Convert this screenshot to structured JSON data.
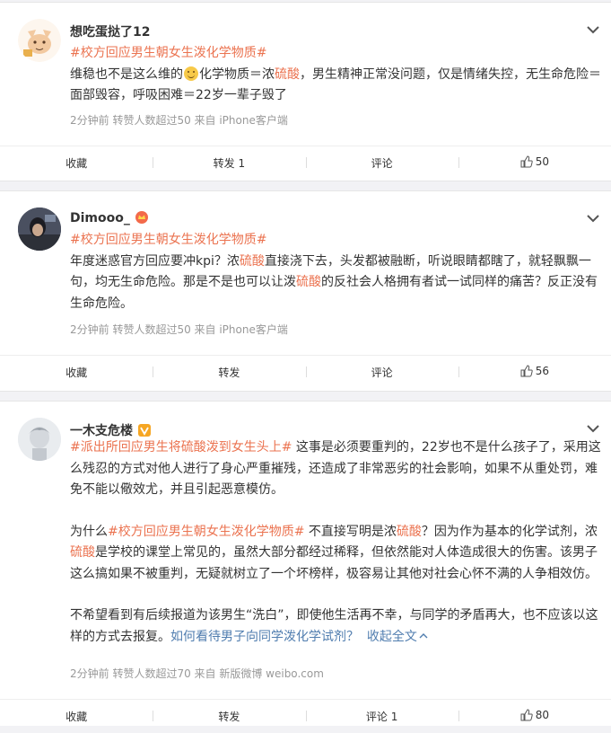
{
  "posts": [
    {
      "username": "想吃蛋挞了12",
      "topic": "#校方回应男生朝女生泼化学物质#",
      "text_a": "维稳也不是这么维的",
      "text_b": "化学物质＝浓",
      "text_c": "硫酸",
      "text_d": "，男生精神正常没问题，仅是情绪失控，无生命危险＝面部毁容，呼吸困难＝22岁一辈子毁了",
      "meta": "2分钟前  转赞人数超过50  来自 iPhone客户端",
      "actions": {
        "collect": "收藏",
        "repost": "转发 1",
        "comment": "评论",
        "likes": "50"
      }
    },
    {
      "username": "Dimooo_",
      "topic": "#校方回应男生朝女生泼化学物质#",
      "text_a": "年度迷惑官方回应要冲kpi？浓",
      "text_b": "硫酸",
      "text_c": "直接浇下去，头发都被融断，听说眼睛都瞎了，就轻飘飘一句，均无生命危险。那是不是也可以让泼",
      "text_d": "硫酸",
      "text_e": "的反社会人格拥有者试一试同样的痛苦？反正没有生命危险。",
      "meta": "2分钟前  转赞人数超过50  来自 iPhone客户端",
      "actions": {
        "collect": "收藏",
        "repost": "转发",
        "comment": "评论",
        "likes": "56"
      }
    },
    {
      "username": "一木支危楼",
      "p1_topic_a": "#派出所回应男生将",
      "p1_topic_b": "硫酸",
      "p1_topic_c": "泼到女生头上#",
      "p1_text": " 这事是必须要重判的，22岁也不是什么孩子了，采用这么残忍的方式对他人进行了身心严重摧残，还造成了非常恶劣的社会影响，如果不从重处罚，难免不能以儆效尤，并且引起恶意模仿。",
      "p2_a": "为什么",
      "p2_topic": "#校方回应男生朝女生泼化学物质#",
      "p2_b": " 不直接写明是浓",
      "p2_c": "硫酸",
      "p2_d": "？因为作为基本的化学试剂，浓",
      "p2_e": "硫酸",
      "p2_f": "是学校的课堂上常见的，虽然大部分都经过稀释，但依然能对人体造成很大的伤害。该男子这么搞如果不被重判，无疑就树立了一个坏榜样，极容易让其他对社会心怀不满的人争相效仿。",
      "p3_text": "不希望看到有后续报道为该男生“洗白”，即使他生活再不幸，与同学的矛盾再大，也不应该以这样的方式去报复。",
      "p3_link": "如何看待男子向同学泼化学试剂？",
      "p3_collapse": "收起全文",
      "meta": "2分钟前  转赞人数超过70  来自 新版微博 weibo.com",
      "actions": {
        "collect": "收藏",
        "repost": "转发",
        "comment": "评论 1",
        "likes": "80"
      }
    }
  ],
  "colors": {
    "topic": "#eb7350",
    "link": "#507daf",
    "meta": "#999999"
  }
}
